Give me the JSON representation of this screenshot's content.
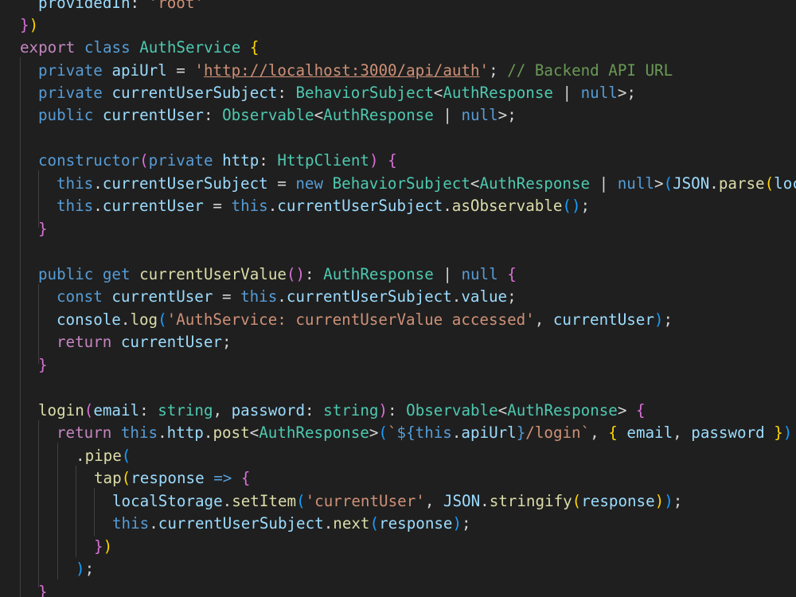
{
  "code": {
    "l00": {
      "prop": "providedIn",
      "colon": ": ",
      "val": "'root'"
    },
    "l01": {
      "brace": "}",
      "paren": ")"
    },
    "l02": {
      "kw1": "export",
      "kw2": "class",
      "name": "AuthService",
      "brace": "{"
    },
    "l03": {
      "mod": "private",
      "prop": "apiUrl",
      "eq": " = ",
      "q1": "'",
      "url": "http://localhost:3000/api/auth",
      "q2": "'",
      "semi": ";",
      "comment": "// Backend API URL"
    },
    "l04": {
      "mod": "private",
      "prop": "currentUserSubject",
      "colon": ": ",
      "type1": "BehaviorSubject",
      "lt": "<",
      "type2": "AuthResponse",
      "pipe": " | ",
      "nul": "null",
      "gt": ">",
      "semi": ";"
    },
    "l05": {
      "mod": "public",
      "prop": "currentUser",
      "colon": ": ",
      "type1": "Observable",
      "lt": "<",
      "type2": "AuthResponse",
      "pipe": " | ",
      "nul": "null",
      "gt": ">",
      "semi": ";"
    },
    "l07": {
      "kw": "constructor",
      "lp": "(",
      "mod": "private",
      "param": "http",
      "colon": ": ",
      "type": "HttpClient",
      "rp": ")",
      "brace": "{"
    },
    "l08": {
      "this": "this",
      "dot": ".",
      "prop": "currentUserSubject",
      "eq": " = ",
      "kwnew": "new",
      "type1": "BehaviorSubject",
      "lt": "<",
      "type2": "AuthResponse",
      "pipe": " | ",
      "nul": "null",
      "gt": ">",
      "lp": "(",
      "json": "JSON",
      "dot2": ".",
      "fn": "parse",
      "lp2": "(",
      "rest": "loc"
    },
    "l09": {
      "this": "this",
      "dot": ".",
      "prop": "currentUser",
      "eq": " = ",
      "this2": "this",
      "dot2": ".",
      "prop2": "currentUserSubject",
      "dot3": ".",
      "fn": "asObservable",
      "parens": "()",
      "semi": ";"
    },
    "l10": {
      "brace": "}"
    },
    "l12": {
      "mod": "public",
      "kwget": "get",
      "fn": "currentUserValue",
      "parens": "()",
      "colon": ": ",
      "type": "AuthResponse",
      "pipe": " | ",
      "nul": "null",
      "brace": "{"
    },
    "l13": {
      "kw": "const",
      "var": "currentUser",
      "eq": " = ",
      "this": "this",
      "dot": ".",
      "prop": "currentUserSubject",
      "dot2": ".",
      "prop2": "value",
      "semi": ";"
    },
    "l14": {
      "obj": "console",
      "dot": ".",
      "fn": "log",
      "lp": "(",
      "str": "'AuthService: currentUserValue accessed'",
      "comma": ", ",
      "var": "currentUser",
      "rp": ")",
      "semi": ";"
    },
    "l15": {
      "kw": "return",
      "var": "currentUser",
      "semi": ";"
    },
    "l16": {
      "brace": "}"
    },
    "l18": {
      "fn": "login",
      "lp": "(",
      "p1": "email",
      "c1": ": ",
      "t1": "string",
      "comma": ", ",
      "p2": "password",
      "c2": ": ",
      "t2": "string",
      "rp": ")",
      "colon": ": ",
      "type1": "Observable",
      "lt": "<",
      "type2": "AuthResponse",
      "gt": ">",
      "brace": "{"
    },
    "l19": {
      "kw": "return",
      "this": "this",
      "dot": ".",
      "prop": "http",
      "dot2": ".",
      "fn": "post",
      "lt": "<",
      "type": "AuthResponse",
      "gt": ">",
      "lp": "(",
      "tick1": "`",
      "tmpl1": "${",
      "this2": "this",
      "dot3": ".",
      "prop2": "apiUrl",
      "tmpl2": "}",
      "path": "/login",
      "tick2": "`",
      "comma": ", ",
      "lb": "{",
      "p1": " email",
      "comma2": ", ",
      "p2": "password",
      "rb": " }",
      "rp": ")"
    },
    "l20": {
      "dot": ".",
      "fn": "pipe",
      "lp": "("
    },
    "l21": {
      "fn": "tap",
      "lp": "(",
      "param": "response",
      "arrow": " => ",
      "brace": "{"
    },
    "l22": {
      "obj": "localStorage",
      "dot": ".",
      "fn": "setItem",
      "lp": "(",
      "str": "'currentUser'",
      "comma": ", ",
      "json": "JSON",
      "dot2": ".",
      "fn2": "stringify",
      "lp2": "(",
      "arg": "response",
      "rp2": ")",
      "rp": ")",
      "semi": ";"
    },
    "l23": {
      "this": "this",
      "dot": ".",
      "prop": "currentUserSubject",
      "dot2": ".",
      "fn": "next",
      "lp": "(",
      "arg": "response",
      "rp": ")",
      "semi": ";"
    },
    "l24": {
      "brace": "}",
      "paren": ")"
    },
    "l25": {
      "paren": ")",
      "semi": ";"
    },
    "l26": {
      "brace": "}"
    }
  },
  "colors": {
    "background": "#1f1f1f",
    "keyword": "#569cd6",
    "control": "#c586c0",
    "variable": "#9cdcfe",
    "type": "#4ec9b0",
    "function": "#dcdcaa",
    "string": "#ce9178",
    "comment": "#6a9955",
    "bracket1": "#ffd700",
    "bracket2": "#da70d6",
    "bracket3": "#179fff"
  }
}
